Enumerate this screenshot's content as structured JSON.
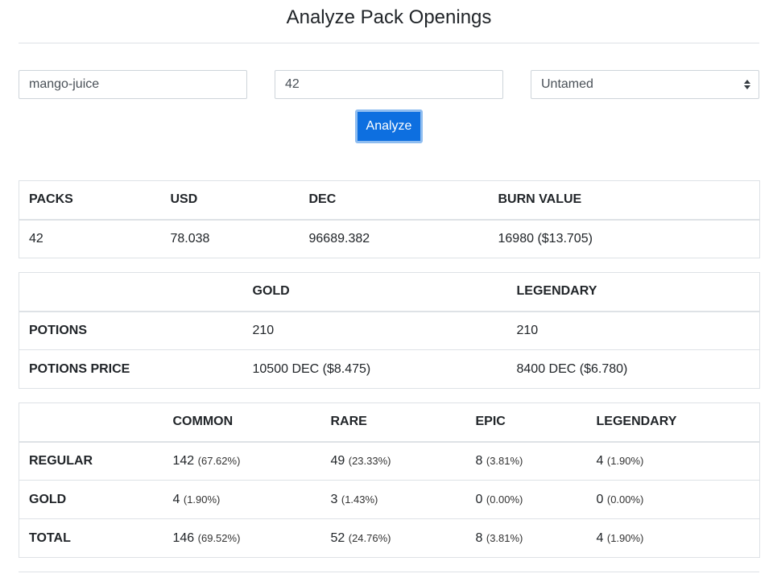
{
  "page": {
    "title": "Analyze Pack Openings"
  },
  "form": {
    "player_value": "mango-juice",
    "packs_value": "42",
    "edition_value": "Untamed",
    "analyze_label": "Analyze"
  },
  "summary": {
    "headers": [
      "PACKS",
      "USD",
      "DEC",
      "BURN VALUE"
    ],
    "row": [
      "42",
      "78.038",
      "96689.382",
      "16980 ($13.705)"
    ]
  },
  "potions": {
    "headers": [
      "",
      "GOLD",
      "LEGENDARY"
    ],
    "rows": [
      {
        "label": "POTIONS",
        "gold": "210",
        "legendary": "210"
      },
      {
        "label": "POTIONS PRICE",
        "gold": "10500 DEC ($8.475)",
        "legendary": "8400 DEC ($6.780)"
      }
    ]
  },
  "rarity": {
    "headers": [
      "",
      "COMMON",
      "RARE",
      "EPIC",
      "LEGENDARY"
    ],
    "rows": [
      {
        "label": "REGULAR",
        "cells": [
          {
            "v": "142",
            "p": "(67.62%)"
          },
          {
            "v": "49",
            "p": "(23.33%)"
          },
          {
            "v": "8",
            "p": "(3.81%)"
          },
          {
            "v": "4",
            "p": "(1.90%)"
          }
        ]
      },
      {
        "label": "GOLD",
        "cells": [
          {
            "v": "4",
            "p": "(1.90%)"
          },
          {
            "v": "3",
            "p": "(1.43%)"
          },
          {
            "v": "0",
            "p": "(0.00%)"
          },
          {
            "v": "0",
            "p": "(0.00%)"
          }
        ]
      },
      {
        "label": "TOTAL",
        "cells": [
          {
            "v": "146",
            "p": "(69.52%)"
          },
          {
            "v": "52",
            "p": "(24.76%)"
          },
          {
            "v": "8",
            "p": "(3.81%)"
          },
          {
            "v": "4",
            "p": "(1.90%)"
          }
        ]
      }
    ]
  },
  "icons": {
    "select_arrows": "select-arrows-icon"
  },
  "colors": {
    "primary": "#0d6fe0",
    "focus_ring": "#8fbdf0",
    "border": "#dee2e6"
  }
}
